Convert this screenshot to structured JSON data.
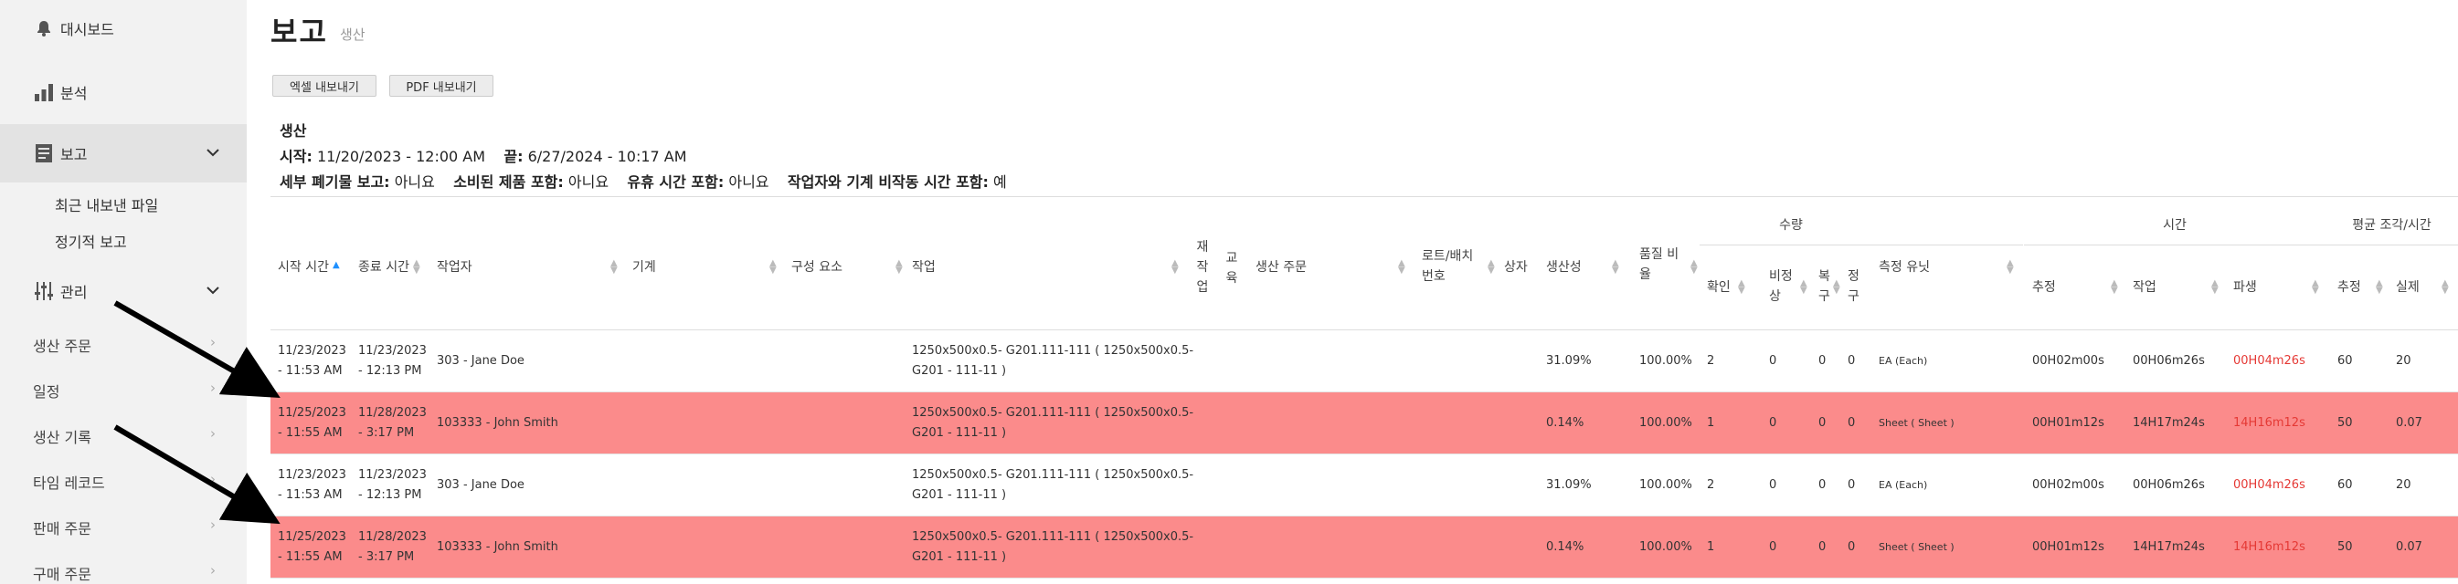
{
  "sidebar": {
    "items": [
      {
        "label": "대시보드",
        "icon": "bell-icon"
      },
      {
        "label": "분석",
        "icon": "bar-chart-icon"
      },
      {
        "label": "보고",
        "icon": "report-icon"
      },
      {
        "label": "관리",
        "icon": "sliders-icon"
      }
    ],
    "report_sub": [
      "최근 내보낸 파일",
      "정기적 보고"
    ],
    "manage_sub": [
      "생산 주문",
      "일정",
      "생산 기록",
      "타임 레코드",
      "판매 주문",
      "구매 주문"
    ],
    "chevron": "›",
    "expand": "⌄"
  },
  "header": {
    "title": "보고",
    "subtitle": "생산"
  },
  "buttons": {
    "excel": "엑셀 내보내기",
    "pdf": "PDF 내보내기"
  },
  "report_info": {
    "name": "생산",
    "start_label": "시작:",
    "start_value": "11/20/2023 - 12:00 AM",
    "end_label": "끝:",
    "end_value": "6/27/2024 - 10:17 AM",
    "detail_scrap_label": "세부 폐기물 보고:",
    "detail_scrap_value": "아니요",
    "consumed_label": "소비된 제품 포함:",
    "consumed_value": "아니요",
    "idle_label": "유휴 시간 포함:",
    "idle_value": "아니요",
    "downtime_label": "작업자와 기계 비작동 시간 포함:",
    "downtime_value": "예"
  },
  "table": {
    "groups": {
      "quantity": "수량",
      "time": "시간",
      "avg_parts": "평균 조각/시간"
    },
    "headers": {
      "start_time": "시작 시간",
      "end_time": "종료 시간",
      "operator": "작업자",
      "machine": "기계",
      "component": "구성 요소",
      "job": "작업",
      "rework_1": "재",
      "rework_2": "작",
      "rework_3": "업",
      "edu_1": "교",
      "edu_2": "육",
      "production_order": "생산 주문",
      "lot_1": "로트/배치",
      "lot_2": "번호",
      "box": "상자",
      "productivity": "생산성",
      "quality_1": "품질 비",
      "quality_2": "율",
      "confirmed": "확인",
      "abnormal_1": "비정",
      "abnormal_2": "상",
      "recovery_1": "복",
      "recovery_2": "구",
      "fix_1": "정",
      "fix_2": "구",
      "unit": "측정 유닛",
      "estimated": "추정",
      "work": "작업",
      "derived": "파생",
      "avg_est": "추정",
      "avg_act": "실제"
    },
    "rows": [
      {
        "highlight": false,
        "start_a": "11/23/2023",
        "start_b": "- 11:53 AM",
        "end_a": "11/23/2023",
        "end_b": "- 12:13 PM",
        "operator": "303 - Jane Doe",
        "job_a": "1250x500x0.5- G201.111-111 ( 1250x500x0.5-",
        "job_b": "G201 - 111-11 )",
        "productivity": "31.09%",
        "quality": "100.00%",
        "confirmed": "2",
        "abnormal": "0",
        "recovery": "0",
        "fix": "0",
        "unit": "EA (Each)",
        "estimated": "00H02m00s",
        "work": "00H06m26s",
        "derived": "00H04m26s",
        "avg_est": "60",
        "avg_act": "20"
      },
      {
        "highlight": true,
        "start_a": "11/25/2023",
        "start_b": "- 11:55 AM",
        "end_a": "11/28/2023",
        "end_b": "- 3:17 PM",
        "operator": "103333 - John Smith",
        "job_a": "1250x500x0.5- G201.111-111 ( 1250x500x0.5-",
        "job_b": "G201 - 111-11 )",
        "productivity": "0.14%",
        "quality": "100.00%",
        "confirmed": "1",
        "abnormal": "0",
        "recovery": "0",
        "fix": "0",
        "unit": "Sheet ( Sheet )",
        "estimated": "00H01m12s",
        "work": "14H17m24s",
        "derived": "14H16m12s",
        "avg_est": "50",
        "avg_act": "0.07"
      },
      {
        "highlight": false,
        "start_a": "11/23/2023",
        "start_b": "- 11:53 AM",
        "end_a": "11/23/2023",
        "end_b": "- 12:13 PM",
        "operator": "303 - Jane Doe",
        "job_a": "1250x500x0.5- G201.111-111 ( 1250x500x0.5-",
        "job_b": "G201 - 111-11 )",
        "productivity": "31.09%",
        "quality": "100.00%",
        "confirmed": "2",
        "abnormal": "0",
        "recovery": "0",
        "fix": "0",
        "unit": "EA (Each)",
        "estimated": "00H02m00s",
        "work": "00H06m26s",
        "derived": "00H04m26s",
        "avg_est": "60",
        "avg_act": "20"
      },
      {
        "highlight": true,
        "start_a": "11/25/2023",
        "start_b": "- 11:55 AM",
        "end_a": "11/28/2023",
        "end_b": "- 3:17 PM",
        "operator": "103333 - John Smith",
        "job_a": "1250x500x0.5- G201.111-111 ( 1250x500x0.5-",
        "job_b": "G201 - 111-11 )",
        "productivity": "0.14%",
        "quality": "100.00%",
        "confirmed": "1",
        "abnormal": "0",
        "recovery": "0",
        "fix": "0",
        "unit": "Sheet ( Sheet )",
        "estimated": "00H01m12s",
        "work": "14H17m24s",
        "derived": "14H16m12s",
        "avg_est": "50",
        "avg_act": "0.07"
      }
    ]
  },
  "colors": {
    "highlight_row": "#fb8b8b",
    "derived_text": "#e53935",
    "sort_active": "#1e90ff"
  }
}
